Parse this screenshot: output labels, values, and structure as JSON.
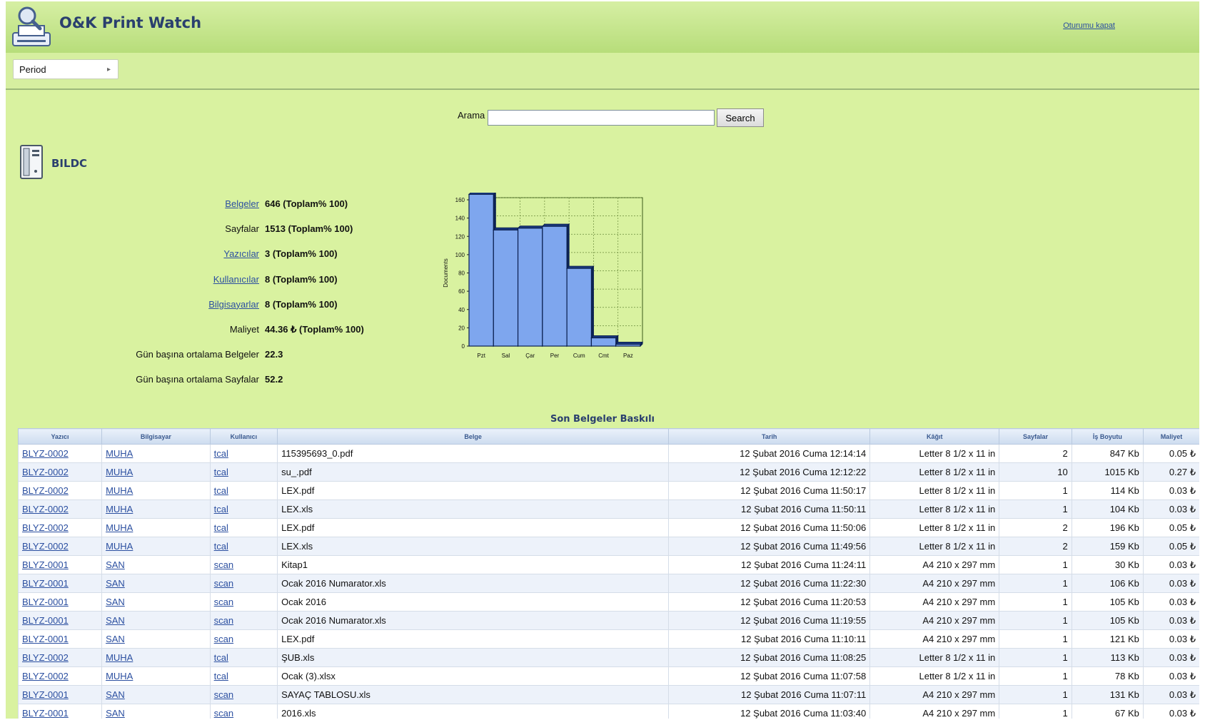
{
  "app": {
    "title": "O&K Print Watch",
    "logout_label": "Oturumu kapat"
  },
  "toolbar": {
    "period_label": "Period"
  },
  "search": {
    "label": "Arama",
    "value": "",
    "placeholder": "",
    "button_label": "Search"
  },
  "computer": {
    "name": "BILDC"
  },
  "stats": [
    {
      "label": "Belgeler",
      "value": "646 (Toplam% 100)",
      "link": true
    },
    {
      "label": "Sayfalar",
      "value": "1513 (Toplam% 100)",
      "link": false
    },
    {
      "label": "Yazıcılar",
      "value": "3 (Toplam% 100)",
      "link": true
    },
    {
      "label": "Kullanıcılar",
      "value": "8 (Toplam% 100)",
      "link": true
    },
    {
      "label": "Bilgisayarlar",
      "value": "8 (Toplam% 100)",
      "link": true
    },
    {
      "label": "Maliyet",
      "value": "44.36 ₺ (Toplam% 100)",
      "link": false
    },
    {
      "label": "Gün başına ortalama Belgeler",
      "value": "22.3",
      "link": false
    },
    {
      "label": "Gün başına ortalama Sayfalar",
      "value": "52.2",
      "link": false
    }
  ],
  "chart_data": {
    "type": "bar",
    "categories": [
      "Pzt",
      "Sal",
      "Çar",
      "Per",
      "Cum",
      "Cmt",
      "Paz"
    ],
    "values": [
      166,
      127,
      129,
      131,
      85,
      9,
      2
    ],
    "ylabel": "Documents",
    "xlabel": "",
    "ylim": [
      0,
      160
    ],
    "yticks": [
      0,
      20,
      40,
      60,
      80,
      100,
      120,
      140,
      160
    ],
    "grid": true,
    "colors": {
      "bar": "#7ea6ee",
      "bar_edge": "#0a1f4f",
      "grid": "#6a8a3a",
      "background": "#d9f2a0"
    }
  },
  "recent": {
    "title": "Son Belgeler Baskılı",
    "columns": [
      "Yazıcı",
      "Bilgisayar",
      "Kullanıcı",
      "Belge",
      "Tarih",
      "Kâğıt",
      "Sayfalar",
      "İş Boyutu",
      "Maliyet"
    ],
    "rows": [
      [
        "BLYZ-0002",
        "MUHA",
        "tcal",
        "115395693_0.pdf",
        "12 Şubat 2016 Cuma 12:14:14",
        "Letter 8 1/2 x 11 in",
        "2",
        "847 Kb",
        "0.05 ₺"
      ],
      [
        "BLYZ-0002",
        "MUHA",
        "tcal",
        "su_.pdf",
        "12 Şubat 2016 Cuma 12:12:22",
        "Letter 8 1/2 x 11 in",
        "10",
        "1015 Kb",
        "0.27 ₺"
      ],
      [
        "BLYZ-0002",
        "MUHA",
        "tcal",
        "LEX.pdf",
        "12 Şubat 2016 Cuma 11:50:17",
        "Letter 8 1/2 x 11 in",
        "1",
        "114 Kb",
        "0.03 ₺"
      ],
      [
        "BLYZ-0002",
        "MUHA",
        "tcal",
        "LEX.xls",
        "12 Şubat 2016 Cuma 11:50:11",
        "Letter 8 1/2 x 11 in",
        "1",
        "104 Kb",
        "0.03 ₺"
      ],
      [
        "BLYZ-0002",
        "MUHA",
        "tcal",
        "LEX.pdf",
        "12 Şubat 2016 Cuma 11:50:06",
        "Letter 8 1/2 x 11 in",
        "2",
        "196 Kb",
        "0.05 ₺"
      ],
      [
        "BLYZ-0002",
        "MUHA",
        "tcal",
        "LEX.xls",
        "12 Şubat 2016 Cuma 11:49:56",
        "Letter 8 1/2 x 11 in",
        "2",
        "159 Kb",
        "0.05 ₺"
      ],
      [
        "BLYZ-0001",
        "SAN",
        "scan",
        "Kitap1",
        "12 Şubat 2016 Cuma 11:24:11",
        "A4 210 x 297 mm",
        "1",
        "30 Kb",
        "0.03 ₺"
      ],
      [
        "BLYZ-0001",
        "SAN",
        "scan",
        "Ocak 2016 Numarator.xls",
        "12 Şubat 2016 Cuma 11:22:30",
        "A4 210 x 297 mm",
        "1",
        "106 Kb",
        "0.03 ₺"
      ],
      [
        "BLYZ-0001",
        "SAN",
        "scan",
        "Ocak 2016",
        "12 Şubat 2016 Cuma 11:20:53",
        "A4 210 x 297 mm",
        "1",
        "105 Kb",
        "0.03 ₺"
      ],
      [
        "BLYZ-0001",
        "SAN",
        "scan",
        "Ocak 2016 Numarator.xls",
        "12 Şubat 2016 Cuma 11:19:55",
        "A4 210 x 297 mm",
        "1",
        "105 Kb",
        "0.03 ₺"
      ],
      [
        "BLYZ-0001",
        "SAN",
        "scan",
        "LEX.pdf",
        "12 Şubat 2016 Cuma 11:10:11",
        "A4 210 x 297 mm",
        "1",
        "121 Kb",
        "0.03 ₺"
      ],
      [
        "BLYZ-0002",
        "MUHA",
        "tcal",
        "ŞUB.xls",
        "12 Şubat 2016 Cuma 11:08:25",
        "Letter 8 1/2 x 11 in",
        "1",
        "113 Kb",
        "0.03 ₺"
      ],
      [
        "BLYZ-0002",
        "MUHA",
        "tcal",
        "Ocak (3).xlsx",
        "12 Şubat 2016 Cuma 11:07:58",
        "Letter 8 1/2 x 11 in",
        "1",
        "78 Kb",
        "0.03 ₺"
      ],
      [
        "BLYZ-0001",
        "SAN",
        "scan",
        "SAYAÇ TABLOSU.xls",
        "12 Şubat 2016 Cuma 11:07:11",
        "A4 210 x 297 mm",
        "1",
        "131 Kb",
        "0.03 ₺"
      ],
      [
        "BLYZ-0001",
        "SAN",
        "scan",
        "2016.xls",
        "12 Şubat 2016 Cuma 11:03:40",
        "A4 210 x 297 mm",
        "1",
        "67 Kb",
        "0.03 ₺"
      ]
    ]
  }
}
